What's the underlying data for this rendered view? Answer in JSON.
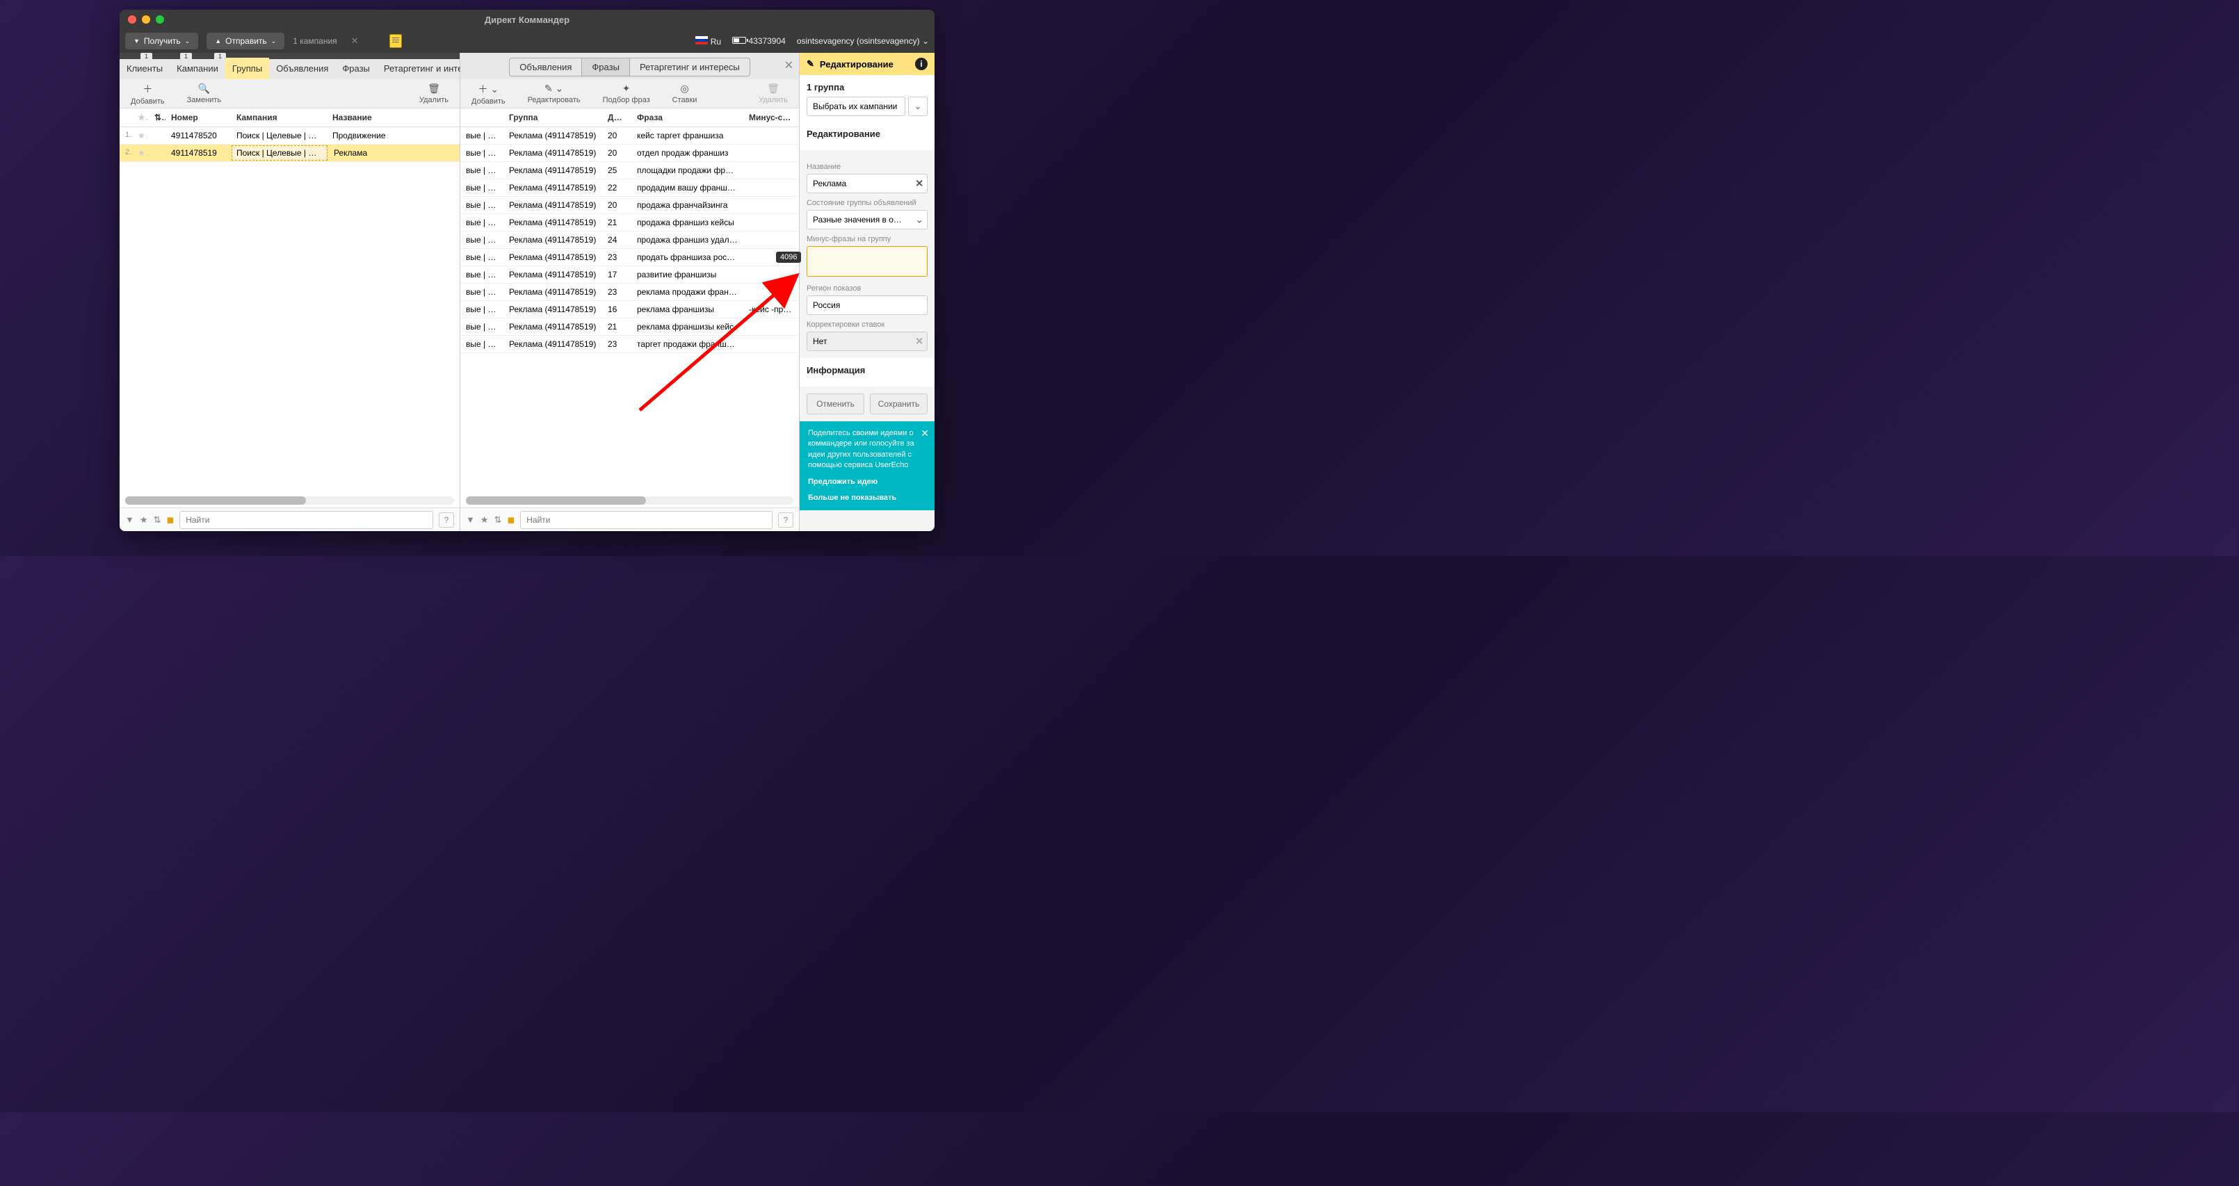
{
  "window": {
    "title": "Директ Коммандер"
  },
  "toolbar": {
    "receive": "Получить",
    "send": "Отправить",
    "status": "1 кампания",
    "lang": "Ru",
    "points": "43373904",
    "user": "osintsevagency (osintsevagency)"
  },
  "left_tabs": {
    "badges": [
      "1",
      "1",
      "1"
    ],
    "items": [
      "Клиенты",
      "Кампании",
      "Группы",
      "Объявления",
      "Фразы",
      "Ретаргетинг и интерес"
    ],
    "active_index": 2
  },
  "left_actions": {
    "add": "Добавить",
    "replace": "Заменить",
    "delete": "Удалить"
  },
  "left_table": {
    "headers": {
      "number": "Номер",
      "campaign": "Кампания",
      "name": "Название"
    },
    "rows": [
      {
        "idx": "1",
        "number": "4911478520",
        "campaign": "Поиск | Целевые | Ф…",
        "name": "Продвижение",
        "selected": false
      },
      {
        "idx": "2",
        "number": "4911478519",
        "campaign": "Поиск | Целевые | Ф…",
        "name": "Реклама",
        "selected": true
      }
    ]
  },
  "center_tabs": {
    "items": [
      "Объявления",
      "Фразы",
      "Ретаргетинг и интересы"
    ],
    "active_index": 1
  },
  "center_actions": {
    "add": "Добавить",
    "edit": "Редактировать",
    "pick": "Подбор фраз",
    "bids": "Ставки",
    "delete": "Удалить"
  },
  "center_table": {
    "headers": {
      "c1": "",
      "c2": "Группа",
      "c3": "Дл…",
      "c4": "Фраза",
      "c5": "Минус-сло…"
    },
    "rows": [
      {
        "c1": "вые | Ф…",
        "c2": "Реклама (4911478519)",
        "c3": "20",
        "c4": "кейс таргет франшиза",
        "c5": ""
      },
      {
        "c1": "вые | Ф…",
        "c2": "Реклама (4911478519)",
        "c3": "20",
        "c4": "отдел продаж франшиз",
        "c5": ""
      },
      {
        "c1": "вые | Ф…",
        "c2": "Реклама (4911478519)",
        "c3": "25",
        "c4": "площадки продажи фр…",
        "c5": ""
      },
      {
        "c1": "вые | Ф…",
        "c2": "Реклама (4911478519)",
        "c3": "22",
        "c4": "продадим вашу франш…",
        "c5": ""
      },
      {
        "c1": "вые | Ф…",
        "c2": "Реклама (4911478519)",
        "c3": "20",
        "c4": "продажа франчайзинга",
        "c5": ""
      },
      {
        "c1": "вые | Ф…",
        "c2": "Реклама (4911478519)",
        "c3": "21",
        "c4": "продажа франшиз кейсы",
        "c5": ""
      },
      {
        "c1": "вые | Ф…",
        "c2": "Реклама (4911478519)",
        "c3": "24",
        "c4": "продажа франшиз удал…",
        "c5": ""
      },
      {
        "c1": "вые | Ф…",
        "c2": "Реклама (4911478519)",
        "c3": "23",
        "c4": "продать франшиза рос…",
        "c5": ""
      },
      {
        "c1": "вые | Ф…",
        "c2": "Реклама (4911478519)",
        "c3": "17",
        "c4": "развитие франшизы",
        "c5": ""
      },
      {
        "c1": "вые | Ф…",
        "c2": "Реклама (4911478519)",
        "c3": "23",
        "c4": "реклама продажи фран…",
        "c5": ""
      },
      {
        "c1": "вые | Ф…",
        "c2": "Реклама (4911478519)",
        "c3": "16",
        "c4": "реклама франшизы",
        "c5": "-кейс -прода…"
      },
      {
        "c1": "вые | Ф…",
        "c2": "Реклама (4911478519)",
        "c3": "21",
        "c4": "реклама франшизы кейс",
        "c5": ""
      },
      {
        "c1": "вые | Ф…",
        "c2": "Реклама (4911478519)",
        "c3": "23",
        "c4": "таргет продажи франш…",
        "c5": ""
      }
    ]
  },
  "footer": {
    "search_placeholder": "Найти"
  },
  "right": {
    "header": "Редактирование",
    "group_count": "1 группа",
    "select_campaign": "Выбрать их кампании",
    "section_edit": "Редактирование",
    "name_label": "Название",
    "name_value": "Реклама",
    "state_label": "Состояние группы объявлений",
    "state_value": "Разные значения в о…",
    "minus_label": "Минус-фразы на группу",
    "minus_counter": "4096",
    "region_label": "Регион показов",
    "region_value": "Россия",
    "bids_label": "Корректировки ставок",
    "bids_value": "Нет",
    "info_section": "Информация",
    "cancel": "Отменить",
    "save": "Сохранить",
    "promo_text": "Поделитесь своими идеями о коммандере или голосуйте за идеи других пользователей с помощью сервиса UserEcho",
    "promo_link1": "Предложить идею",
    "promo_link2": "Больше не показывать"
  }
}
